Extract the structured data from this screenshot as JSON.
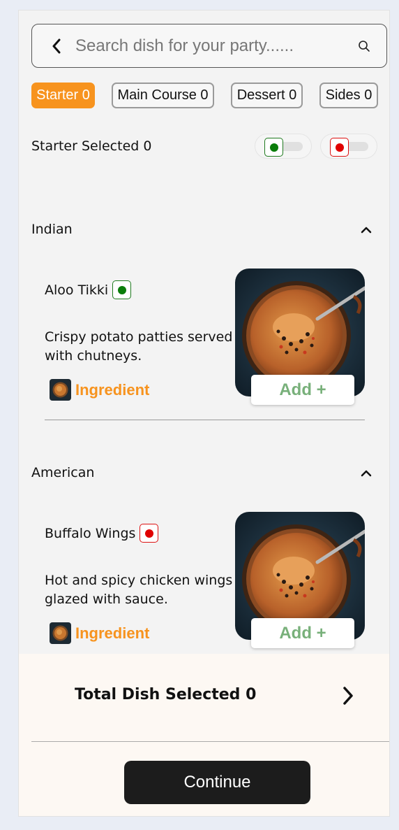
{
  "search": {
    "placeholder": "Search dish for your party......"
  },
  "tabs": [
    {
      "label": "Starter 0",
      "active": true
    },
    {
      "label": "Main Course 0",
      "active": false
    },
    {
      "label": "Dessert 0",
      "active": false
    },
    {
      "label": "Sides 0",
      "active": false
    }
  ],
  "selected_text": "Starter Selected 0",
  "filters": {
    "veg_color": "#0a7d0a",
    "nonveg_color": "#e00000"
  },
  "sections": [
    {
      "label": "Indian",
      "dish": {
        "name": "Aloo Tikki",
        "type": "veg",
        "description": "Crispy potato patties served with chutneys.",
        "ingredient_label": "Ingredient",
        "add_label": "Add +"
      }
    },
    {
      "label": "American",
      "dish": {
        "name": "Buffalo Wings",
        "type": "nonveg",
        "description": "Hot and spicy chicken wings glazed with sauce.",
        "ingredient_label": "Ingredient",
        "add_label": "Add +"
      }
    }
  ],
  "footer": {
    "total_label": "Total Dish Selected 0",
    "continue_label": "Continue"
  },
  "colors": {
    "accent": "#f7931e",
    "add_text": "#78b07a"
  }
}
